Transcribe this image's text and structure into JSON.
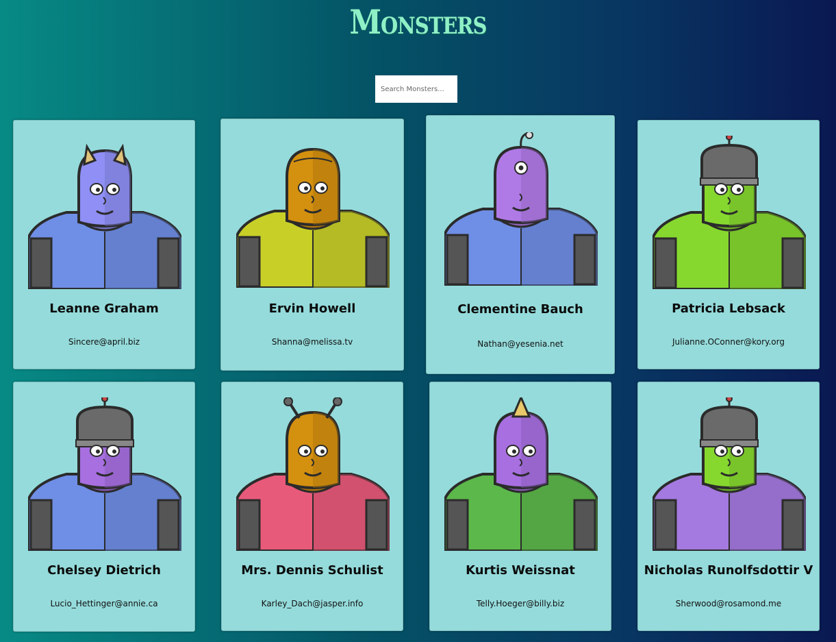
{
  "title": "Monsters",
  "search": {
    "placeholder": "Search Monsters..."
  },
  "colors": {
    "background_start": "#078a85",
    "background_end": "#0a1852",
    "title": "#8ff0c6",
    "card": "#95dbdb"
  },
  "monsters": [
    {
      "name": "Leanne Graham",
      "email": "Sincere@april.biz",
      "skin": "#8f8ff5",
      "suit": "#6f8ee6",
      "feature": "horns"
    },
    {
      "name": "Ervin Howell",
      "email": "Shanna@melissa.tv",
      "skin": "#d4900f",
      "suit": "#c8d028",
      "feature": "hood"
    },
    {
      "name": "Clementine Bauch",
      "email": "Nathan@yesenia.net",
      "skin": "#b07ae6",
      "suit": "#6f8ee6",
      "feature": "antenna-eye"
    },
    {
      "name": "Patricia Lebsack",
      "email": "Julianne.OConner@kory.org",
      "skin": "#86d82e",
      "suit": "#86d82e",
      "feature": "helmet"
    },
    {
      "name": "Chelsey Dietrich",
      "email": "Lucio_Hettinger@annie.ca",
      "skin": "#a76fe0",
      "suit": "#6f8ee6",
      "feature": "helmet"
    },
    {
      "name": "Mrs. Dennis Schulist",
      "email": "Karley_Dach@jasper.info",
      "skin": "#d4900f",
      "suit": "#e85a7a",
      "feature": "antennae"
    },
    {
      "name": "Kurtis Weissnat",
      "email": "Telly.Hoeger@billy.biz",
      "skin": "#a76fe0",
      "suit": "#5cb84a",
      "feature": "horn"
    },
    {
      "name": "Nicholas Runolfsdottir V",
      "email": "Sherwood@rosamond.me",
      "skin": "#86d82e",
      "suit": "#a47ae0",
      "feature": "helmet"
    }
  ]
}
